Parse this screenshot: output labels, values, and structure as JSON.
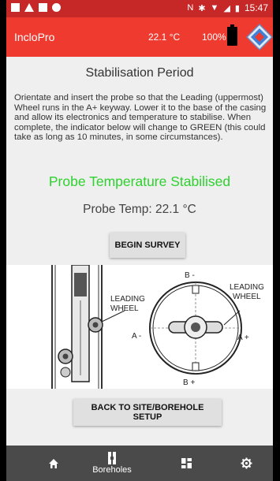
{
  "status_bar": {
    "time": "15:47"
  },
  "app_bar": {
    "title": "IncloPro",
    "temperature": "22.1 °C",
    "battery_percent": "100%"
  },
  "main": {
    "heading": "Stabilisation Period",
    "instructions": "Orientate and insert the probe so that the Leading (uppermost) Wheel runs in the A+ keyway.  Lower it to the base of the casing and allow its electronics and temperature to stabilise.  When complete, the indicator below will change to GREEN (this could take as long as 10 minutes, in some circumstances).",
    "status": "Probe Temperature Stabilised",
    "status_color": "#2ed12e",
    "probe_temp": "Probe Temp: 22.1 °C",
    "begin_button": "BEGIN SURVEY",
    "back_button": "BACK TO SITE/BOREHOLE SETUP"
  },
  "diagram": {
    "left_label_line1": "LEADING",
    "left_label_line2": "WHEEL",
    "right_label_line1": "LEADING",
    "right_label_line2": "WHEEL",
    "b_minus": "B -",
    "b_plus": "B +",
    "a_minus": "A -",
    "a_plus": "A +"
  },
  "nav": {
    "items": [
      {
        "icon": "home-icon",
        "label": ""
      },
      {
        "icon": "borehole-icon",
        "label": "Boreholes"
      },
      {
        "icon": "dashboard-icon",
        "label": ""
      },
      {
        "icon": "settings-icon",
        "label": ""
      }
    ]
  },
  "colors": {
    "status_bar": "#c62828",
    "app_bar": "#ef3a2f",
    "nav_bar": "#4a4a4a"
  }
}
